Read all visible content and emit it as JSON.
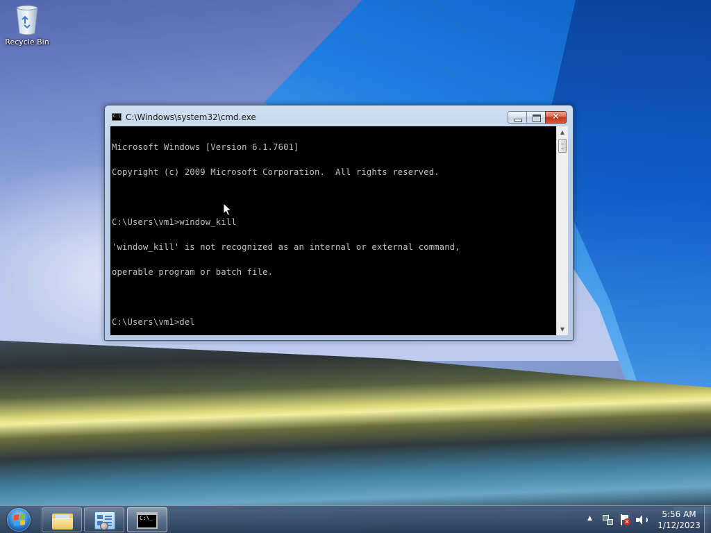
{
  "desktop": {
    "icons": [
      {
        "label": "Recycle Bin",
        "icon": "recycle-bin-icon"
      }
    ]
  },
  "cmd_window": {
    "title": "C:\\Windows\\system32\\cmd.exe",
    "title_icon_text": "C:\\",
    "controls": {
      "minimize": "minimize-icon",
      "maximize": "maximize-icon",
      "close": "close-icon",
      "close_glyph": "✕"
    },
    "console_lines": [
      "Microsoft Windows [Version 6.1.7601]",
      "Copyright (c) 2009 Microsoft Corporation.  All rights reserved.",
      "",
      "C:\\Users\\vm1>window_kill",
      "'window_kill' is not recognized as an internal or external command,",
      "operable program or batch file.",
      "",
      "C:\\Users\\vm1>del"
    ],
    "console_colors": {
      "background": "#000000",
      "text": "#c0c0c0"
    }
  },
  "taskbar": {
    "start": "windows-start-orb-icon",
    "pinned": [
      {
        "name": "windows-explorer",
        "icon": "folder-icon"
      },
      {
        "name": "control-panel",
        "icon": "control-panel-icon"
      },
      {
        "name": "command-prompt",
        "icon": "cmd-icon",
        "active": true,
        "icon_text": "C:\\_"
      }
    ],
    "tray": {
      "expand_arrow": "▲",
      "icons": [
        "network-icon",
        "action-center-flag-icon",
        "volume-icon"
      ],
      "time": "5:56 AM",
      "date": "1/12/2023"
    }
  }
}
